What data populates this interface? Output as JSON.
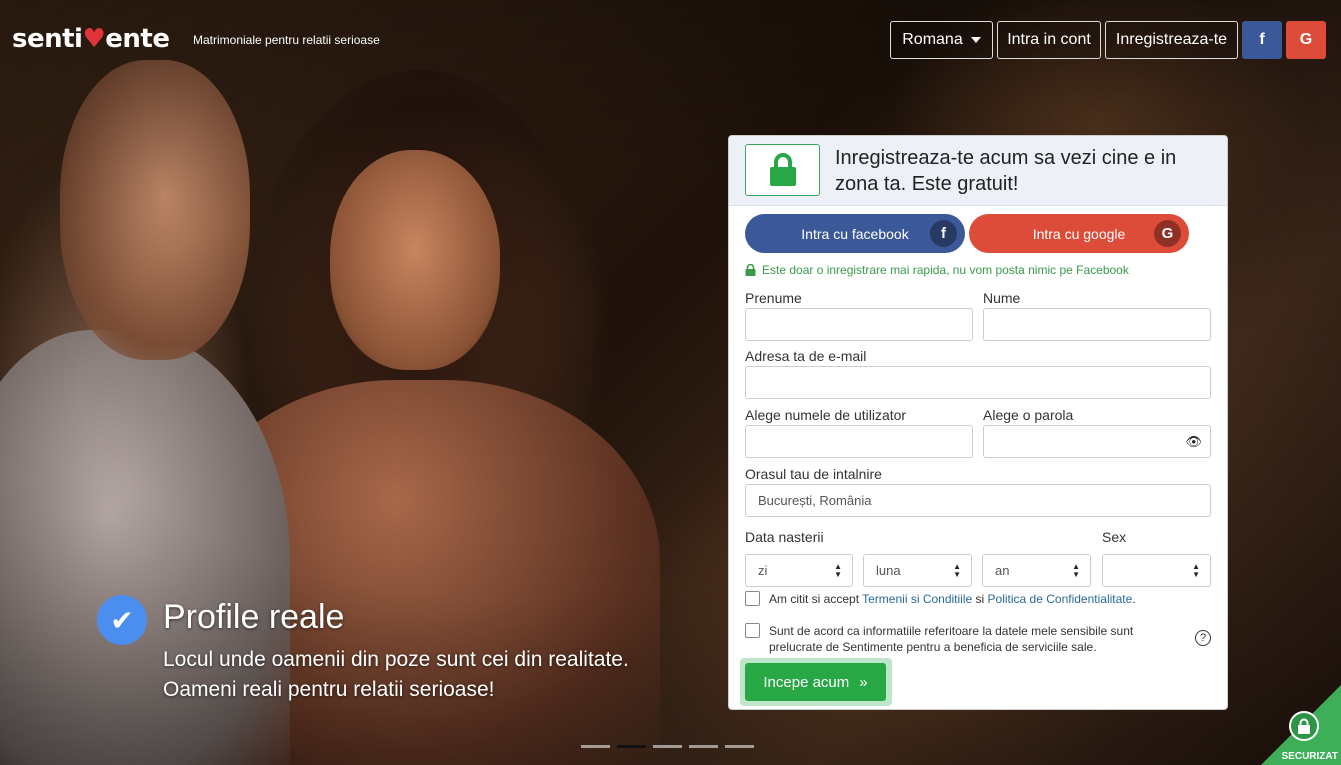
{
  "header": {
    "logo_left": "senti",
    "logo_right": "ente",
    "tagline": "Matrimoniale pentru relatii serioase",
    "language": "Romana",
    "login_label": "Intra in cont",
    "register_label": "Inregistreaza-te",
    "facebook_letter": "f",
    "google_letter": "G"
  },
  "feature": {
    "check": "✔",
    "title": "Profile reale",
    "line1": "Locul unde oamenii din poze sunt cei din realitate.",
    "line2": "Oameni reali pentru relatii serioase!"
  },
  "panel": {
    "title": "Inregistreaza-te acum sa vezi cine e in zona ta. Este gratuit!",
    "facebook_button": "Intra cu facebook",
    "facebook_badge": "f",
    "google_button": "Intra cu google",
    "google_badge": "G",
    "notice": "Este doar o inregistrare mai rapida, nu vom posta nimic pe Facebook",
    "first_name_label": "Prenume",
    "last_name_label": "Nume",
    "email_label": "Adresa ta de e-mail",
    "username_label": "Alege numele de utilizator",
    "password_label": "Alege o parola",
    "city_label": "Orasul tau de intalnire",
    "city_value": "București, România",
    "birth_label": "Data nasterii",
    "sex_label": "Sex",
    "day_placeholder": "zi",
    "month_placeholder": "luna",
    "year_placeholder": "an",
    "sex_value": "",
    "terms_prefix": "Am citit si accept ",
    "terms_link": "Termenii si Conditiile",
    "terms_mid": " si ",
    "privacy_link": "Politica de Confidentialitate",
    "terms_suffix": ".",
    "consent_text": "Sunt de acord ca informatiile referitoare la datele mele sensibile sunt prelucrate de Sentimente pentru a beneficia de serviciile sale.",
    "help_icon": "?",
    "start_button": "Incepe acum",
    "start_arrow": "»"
  },
  "secured_label": "SECURIZAT",
  "colors": {
    "facebook": "#3b5998",
    "google": "#dd4b39",
    "accent_green": "#28a745",
    "check_blue": "#4a8ef0"
  },
  "carousel": {
    "slides": 5,
    "active_index": 1
  }
}
